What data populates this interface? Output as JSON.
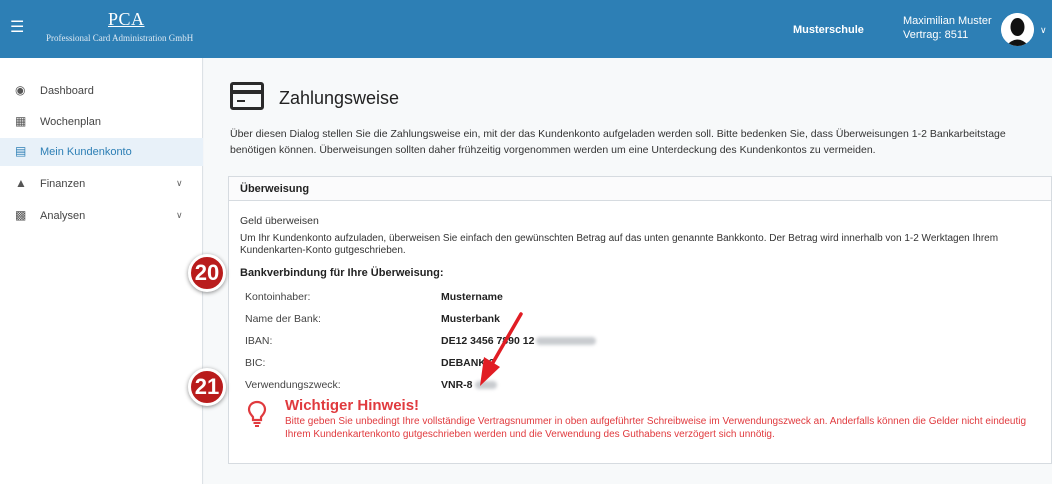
{
  "header": {
    "logo_main": "PCA",
    "logo_sub": "Professional Card Administration GmbH",
    "school": "Musterschule",
    "user_name": "Maximilian Muster",
    "contract": "Vertrag: 8511",
    "brand_color": "#2d7fb5"
  },
  "sidebar": {
    "items": [
      {
        "label": "Dashboard",
        "icon": "dashboard-icon"
      },
      {
        "label": "Wochenplan",
        "icon": "calendar-icon"
      },
      {
        "label": "Mein Kundenkonto",
        "icon": "card-icon",
        "active": true
      },
      {
        "label": "Finanzen",
        "icon": "bank-icon",
        "expandable": true
      },
      {
        "label": "Analysen",
        "icon": "chart-icon",
        "expandable": true
      }
    ]
  },
  "main": {
    "title": "Zahlungsweise",
    "intro": "Über diesen Dialog stellen Sie die Zahlungsweise ein, mit der das Kundenkonto aufgeladen werden soll. Bitte bedenken Sie, dass Überweisungen 1-2 Bankarbeitstage benötigen können. Überweisungen sollten daher frühzeitig vorgenommen werden um eine Unterdeckung des Kundenkontos zu vermeiden.",
    "card": {
      "header": "Überweisung",
      "subtitle": "Geld überweisen",
      "description": "Um Ihr Kundenkonto aufzuladen, überweisen Sie einfach den gewünschten Betrag auf das unten genannte Bankkonto. Der Betrag wird innerhalb von 1-2 Werktagen Ihrem Kundenkarten-Konto gutgeschrieben.",
      "bank_title": "Bankverbindung für Ihre Überweisung:",
      "rows": [
        {
          "key": "Kontoinhaber:",
          "value": "Mustername"
        },
        {
          "key": "Name der Bank:",
          "value": "Musterbank"
        },
        {
          "key": "IBAN:",
          "value": "DE12 3456 7890 12"
        },
        {
          "key": "BIC:",
          "value": "DEBANK 3"
        },
        {
          "key": "Verwendungszweck:",
          "value": "VNR-8"
        }
      ],
      "hint_title": "Wichtiger Hinweis!",
      "hint_text": "Bitte geben Sie unbedingt Ihre vollständige Vertragsnummer in oben aufgeführter Schreibweise im Verwendungszweck an. Anderfalls können die Gelder nicht eindeutig Ihrem Kundenkartenkonto gutgeschrieben werden und die Verwendung des Guthabens verzögert sich unnötig."
    }
  },
  "annotations": {
    "badge_20": "20",
    "badge_21": "21",
    "accent": "#b91c1c",
    "warning_color": "#e03a3e"
  }
}
